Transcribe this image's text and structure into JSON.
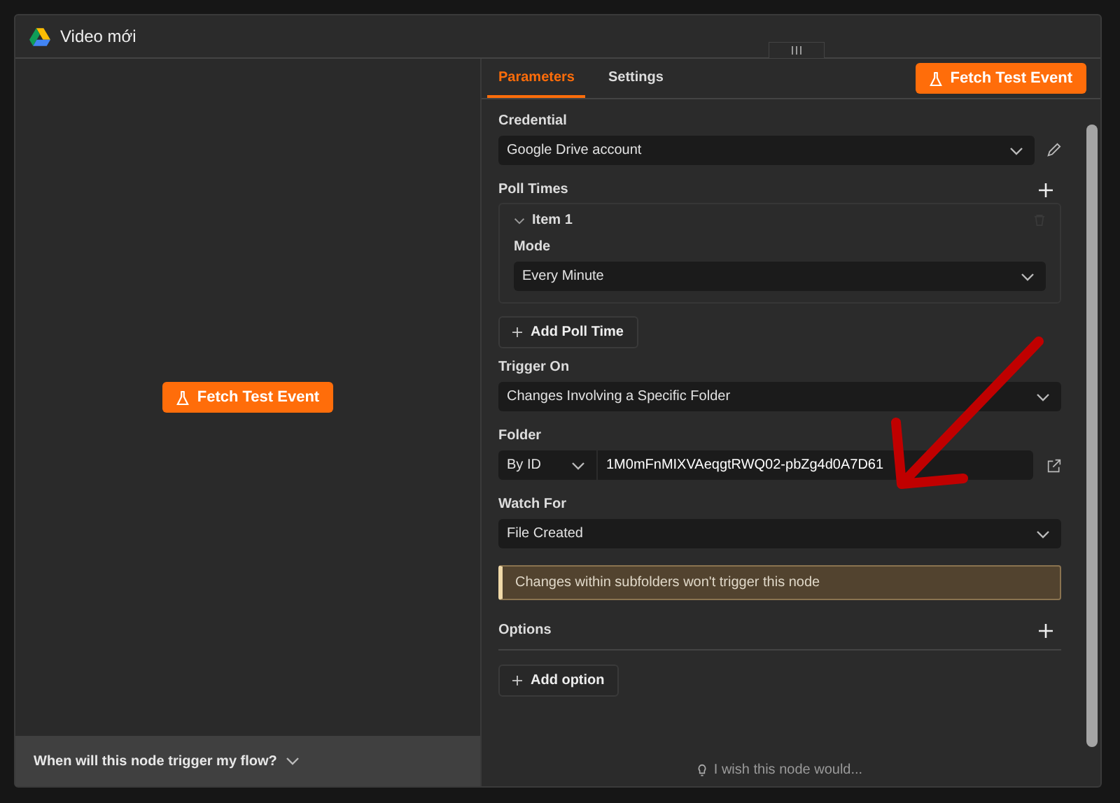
{
  "window": {
    "title": "Video mới"
  },
  "canvas": {
    "button": "Fetch Test Event",
    "footer": "When will this node trigger my flow?"
  },
  "tabs": [
    {
      "label": "Parameters",
      "selected": true
    },
    {
      "label": "Settings",
      "selected": false
    }
  ],
  "header_button": "Fetch Test Event",
  "credential": {
    "label": "Credential",
    "value": "Google Drive account"
  },
  "poll_times": {
    "label": "Poll Times",
    "items": [
      {
        "title": "Item 1",
        "expanded": true,
        "mode_label": "Mode",
        "mode": "Every Minute"
      }
    ],
    "add_button": "Add Poll Time"
  },
  "trigger_on": {
    "label": "Trigger On",
    "value": "Changes Involving a Specific Folder"
  },
  "folder": {
    "label": "Folder",
    "mode": "By ID",
    "value": "1M0mFnMIXVAeqgtRWQ02-pbZg4d0A7D61"
  },
  "watch_for": {
    "label": "Watch For",
    "value": "File Created"
  },
  "notice": "Changes within subfolders won't trigger this node",
  "options": {
    "label": "Options",
    "add_button": "Add option"
  },
  "feedback": "I wish this node would..."
}
